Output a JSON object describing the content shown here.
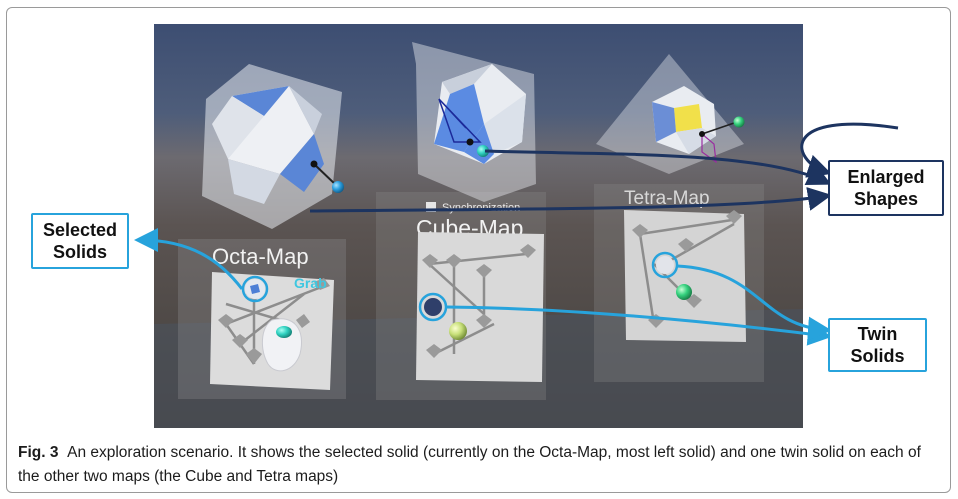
{
  "figure": {
    "label": "Fig. 3",
    "caption": "An exploration scenario. It shows the selected solid (currently on the Octa-Map, most left solid) and one twin solid on each of the other two maps (the Cube and Tetra maps)"
  },
  "callouts": {
    "selected": "Selected\nSolids",
    "enlarged": "Enlarged\nShapes",
    "twin": "Twin\nSolids"
  },
  "scene": {
    "maps": [
      "Octa-Map",
      "Cube-Map",
      "Tetra-Map"
    ],
    "sync_label": "Synchronization",
    "grab_label": "Grab"
  },
  "colors": {
    "callout_light": "#27a3dc",
    "callout_dark": "#1d3460",
    "solid_face": "#e9ecf2",
    "solid_face_blue": "#4d7fd6",
    "solid_face_yellow": "#f1e04a",
    "handle_sphere": "#2fd1c0"
  }
}
